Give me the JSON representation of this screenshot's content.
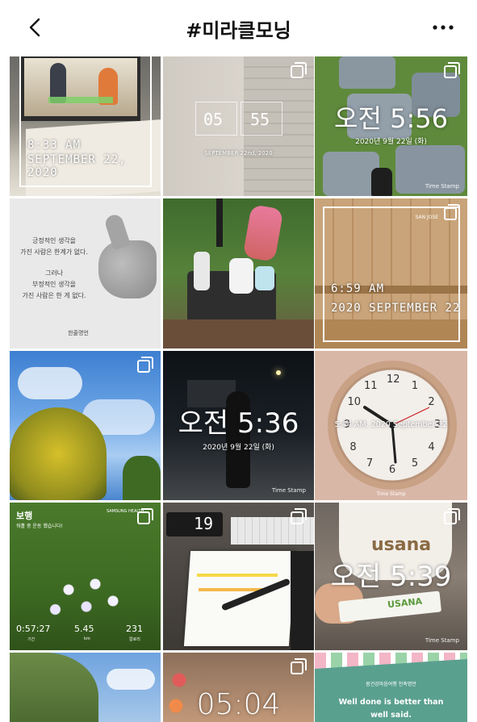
{
  "header": {
    "title": "#미라클모닝"
  },
  "posts": {
    "p1": {
      "time": "8:33 AM",
      "date": "SEPTEMBER 22, 2020"
    },
    "p2": {
      "hour": "05",
      "minute": "55",
      "date": "SEPTEMBER 22nd, 2020"
    },
    "p3": {
      "time": "오전 5:56",
      "date": "2020년 9월 22일 (화)",
      "brand": "Time Stamp"
    },
    "p4": {
      "line1": "긍정적인 생각을",
      "line2": "가진 사람은 한계가 없다.",
      "line3": "그러나",
      "line4": "부정적인 생각을",
      "line5": "가진 사람은 한 게 없다.",
      "author": "한줄명언"
    },
    "p6": {
      "time": "6:59 AM",
      "date": "2020 SEPTEMBER 22",
      "loc": "SAN JOSE"
    },
    "p8": {
      "time": "오전 5:36",
      "date": "2020년 9월 22일 (화)",
      "brand": "Time Stamp"
    },
    "p9": {
      "stamp": "5:44 AM, 2020 September 22",
      "brand": "Time Stamp",
      "numbers": [
        "12",
        "1",
        "2",
        "3",
        "4",
        "5",
        "6",
        "7",
        "8",
        "9",
        "10",
        "11"
      ]
    },
    "p10": {
      "activity": "보행",
      "subtitle": "워홀 중 운동 했습니다!",
      "brand": "SAMSUNG HEALTH",
      "duration": "0:57:27",
      "duration_label": "기간",
      "distance": "5.45",
      "distance_label": "km",
      "calories": "231",
      "calories_label": "칼로리"
    },
    "p11": {
      "digits": "19"
    },
    "p12": {
      "time": "오전 5:39",
      "cup": "usana",
      "packet": "USANA",
      "brand": "Time Stamp"
    },
    "p14": {
      "time": "05:04"
    },
    "p15": {
      "org": "몸건강마음여행 천축명언",
      "quote_line1": "Well done is better than",
      "quote_line2": "well said."
    }
  },
  "colors": {
    "accent": "#ffffff",
    "text": "#111111"
  }
}
